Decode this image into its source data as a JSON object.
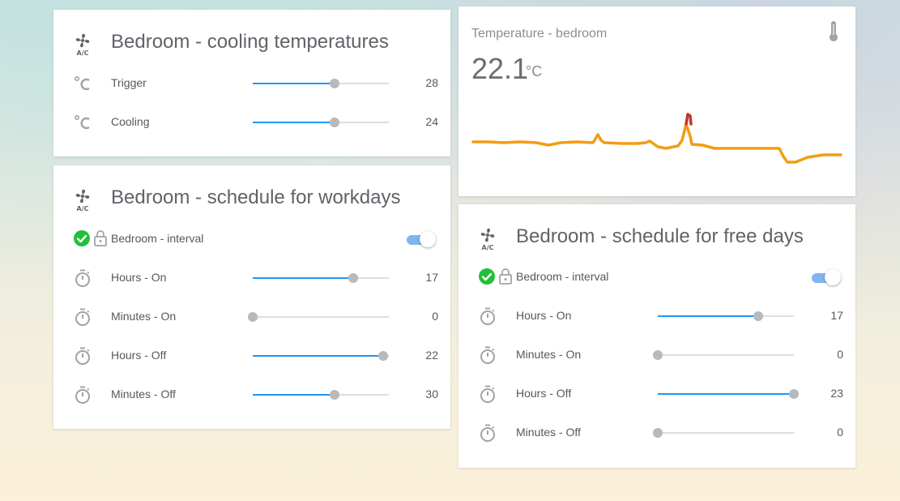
{
  "colors": {
    "accent": "#2196f3",
    "slider_track": "#dedede",
    "slider_thumb": "#b8b9bb",
    "toggle_track": "#7fb6f1",
    "check": "#22c03a",
    "graph_line": "#f39c12",
    "graph_peak": "#c0392b"
  },
  "cooling_card": {
    "title": "Bedroom - cooling temperatures",
    "icon": "ac-icon",
    "rows": [
      {
        "icon": "thermometer-celsius-icon",
        "label": "Trigger",
        "value": "28",
        "level": 0.6
      },
      {
        "icon": "thermometer-celsius-icon",
        "label": "Cooling",
        "value": "24",
        "level": 0.6
      }
    ]
  },
  "sensor_card": {
    "name": "Temperature - bedroom",
    "value": "22.1",
    "unit": "°C",
    "icon": "thermometer-icon"
  },
  "workdays_card": {
    "title": "Bedroom - schedule for workdays",
    "icon": "ac-icon",
    "interval": {
      "label": "Bedroom - interval",
      "checked": true,
      "locked": true,
      "toggle_on": true
    },
    "rows": [
      {
        "icon": "timer-icon",
        "label": "Hours - On",
        "value": "17",
        "level": 0.74
      },
      {
        "icon": "timer-icon",
        "label": "Minutes - On",
        "value": "0",
        "level": 0.0
      },
      {
        "icon": "timer-icon",
        "label": "Hours - Off",
        "value": "22",
        "level": 0.96
      },
      {
        "icon": "timer-icon",
        "label": "Minutes - Off",
        "value": "30",
        "level": 0.6
      }
    ]
  },
  "freedays_card": {
    "title": "Bedroom - schedule for free days",
    "icon": "ac-icon",
    "interval": {
      "label": "Bedroom - interval",
      "checked": true,
      "locked": true,
      "toggle_on": true
    },
    "rows": [
      {
        "icon": "timer-icon",
        "label": "Hours - On",
        "value": "17",
        "level": 0.74
      },
      {
        "icon": "timer-icon",
        "label": "Minutes - On",
        "value": "0",
        "level": 0.0
      },
      {
        "icon": "timer-icon",
        "label": "Hours - Off",
        "value": "23",
        "level": 1.0
      },
      {
        "icon": "timer-icon",
        "label": "Minutes - Off",
        "value": "0",
        "level": 0.0
      }
    ]
  }
}
